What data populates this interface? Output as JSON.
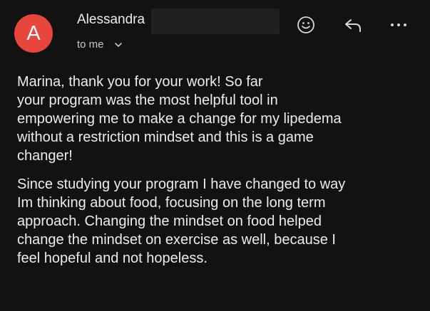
{
  "header": {
    "avatar_letter": "A",
    "sender_name": "Alessandra",
    "recipient_label": "to me"
  },
  "icons": {
    "emoji": "smiley-face-icon",
    "reply": "reply-arrow-icon",
    "more": "more-horizontal-icon",
    "expand": "chevron-down-icon"
  },
  "colors": {
    "background": "#121212",
    "avatar": "#e8453c",
    "text": "#ececec"
  },
  "message": {
    "paragraph_1": "Marina, thank you for your work! So far\nyour program was the most helpful tool in\nempowering me to make a change for my lipedema\nwithout a restriction mindset and this is a game\nchanger!",
    "paragraph_2": "Since studying your program I have changed to way\nIm thinking about food, focusing on the long term\napproach. Changing the mindset on food helped\nchange the mindset on exercise as well, because I\nfeel hopeful and not hopeless."
  }
}
